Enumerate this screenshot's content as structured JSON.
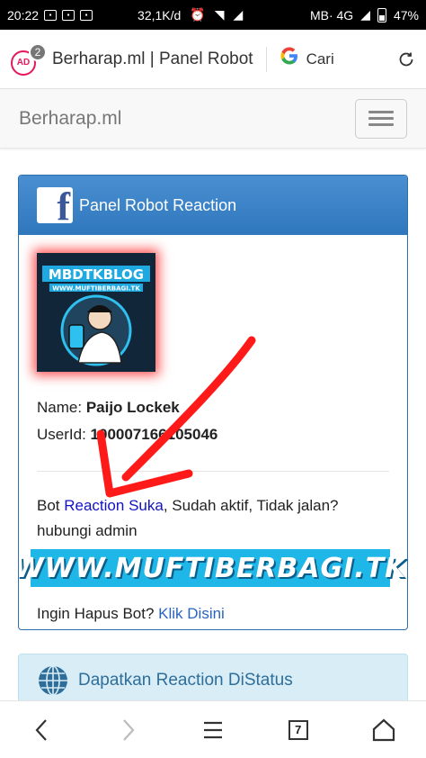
{
  "status_bar": {
    "time": "20:22",
    "speed": "32,1K/d",
    "network": "MB· 4G",
    "battery": "47%"
  },
  "browser": {
    "tab_count": "2",
    "ad_icon_text": "AD",
    "page_title": "Berharap.ml | Panel Robot",
    "search_label": "Cari"
  },
  "site": {
    "brand": "Berharap.ml"
  },
  "panel": {
    "title": "Panel Robot Reaction",
    "avatar_title": "MBDTKBLOG",
    "avatar_subtitle": "WWW.MUFTIBERBAGI.TK",
    "name_label": "Name:",
    "name_value": "Paijo Lockek",
    "userid_label": "UserId:",
    "userid_value": "100007166105046",
    "status_prefix": "Bot ",
    "status_link": "Reaction Suka",
    "status_suffix": ", Sudah aktif, Tidak jalan? hubungi admin",
    "watermark": "WWW.MUFTIBERBAGI.TK",
    "delete_prefix": "Ingin Hapus Bot? ",
    "delete_link": "Klik Disini"
  },
  "panel2": {
    "title": "Dapatkan Reaction DiStatus"
  },
  "bottom_nav": {
    "tabs_count": "7"
  },
  "colors": {
    "panel_header": "#3a80c6",
    "link": "#2a64c0",
    "annotation_arrow": "#ff1a1a",
    "watermark_bg": "#1fb6e8"
  },
  "icons": [
    "facebook-icon",
    "globe-icon",
    "refresh-icon",
    "back-icon",
    "forward-icon",
    "menu-icon",
    "home-icon",
    "google-icon",
    "hamburger-icon"
  ]
}
